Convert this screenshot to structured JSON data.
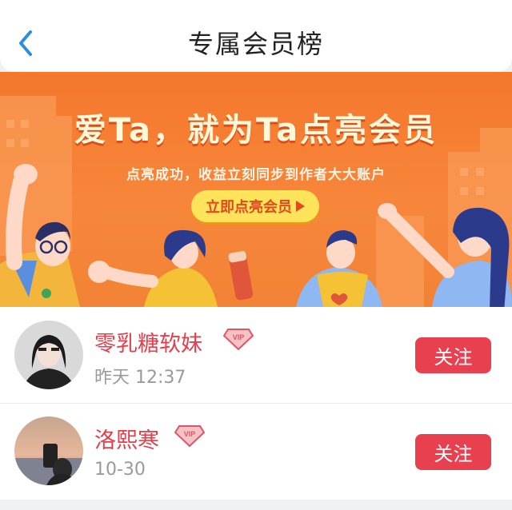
{
  "header": {
    "title": "专属会员榜",
    "back_icon": "chevron-left-icon"
  },
  "banner": {
    "title": "爱Ta，就为Ta点亮会员",
    "subtitle": "点亮成功，收益立刻同步到作者大大账户",
    "cta_label": "立即点亮会员"
  },
  "members": [
    {
      "name": "零乳糖软妹",
      "time": "昨天 12:37",
      "badge": "VIP",
      "follow_label": "关注"
    },
    {
      "name": "洛熙寒",
      "time": "10-30",
      "badge": "VIP",
      "follow_label": "关注"
    }
  ],
  "colors": {
    "accent_red": "#e8404e",
    "name_red": "#e53e4a",
    "banner_orange": "#f4772c",
    "cta_yellow": "#ffe35a",
    "back_blue": "#2a8de0"
  }
}
